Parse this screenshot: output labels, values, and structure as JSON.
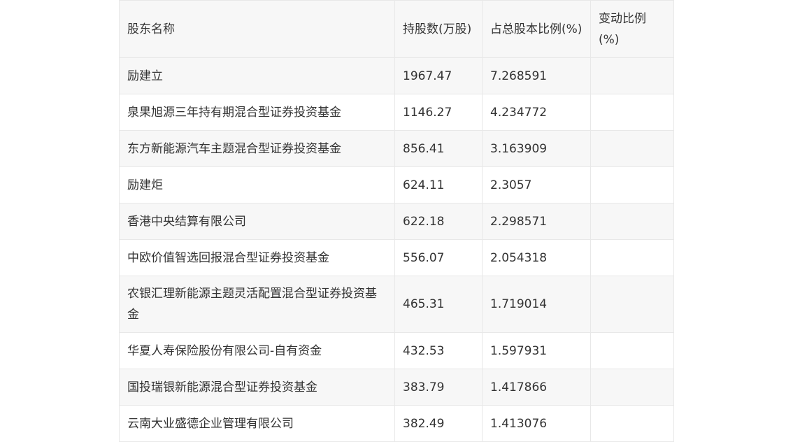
{
  "table": {
    "headers": [
      "股东名称",
      "持股数(万股)",
      "占总股本比例(%)",
      "变动比例(%)"
    ],
    "rows": [
      {
        "name": "励建立",
        "shares": "1967.47",
        "ratio": "7.268591",
        "change": ""
      },
      {
        "name": "泉果旭源三年持有期混合型证券投资基金",
        "shares": "1146.27",
        "ratio": "4.234772",
        "change": ""
      },
      {
        "name": "东方新能源汽车主题混合型证券投资基金",
        "shares": "856.41",
        "ratio": "3.163909",
        "change": ""
      },
      {
        "name": "励建炬",
        "shares": "624.11",
        "ratio": "2.3057",
        "change": ""
      },
      {
        "name": "香港中央结算有限公司",
        "shares": "622.18",
        "ratio": "2.298571",
        "change": ""
      },
      {
        "name": "中欧价值智选回报混合型证券投资基金",
        "shares": "556.07",
        "ratio": "2.054318",
        "change": ""
      },
      {
        "name": "农银汇理新能源主题灵活配置混合型证券投资基金",
        "shares": "465.31",
        "ratio": "1.719014",
        "change": ""
      },
      {
        "name": "华夏人寿保险股份有限公司-自有资金",
        "shares": "432.53",
        "ratio": "1.597931",
        "change": ""
      },
      {
        "name": "国投瑞银新能源混合型证券投资基金",
        "shares": "383.79",
        "ratio": "1.417866",
        "change": ""
      },
      {
        "name": "云南大业盛德企业管理有限公司",
        "shares": "382.49",
        "ratio": "1.413076",
        "change": ""
      }
    ]
  }
}
